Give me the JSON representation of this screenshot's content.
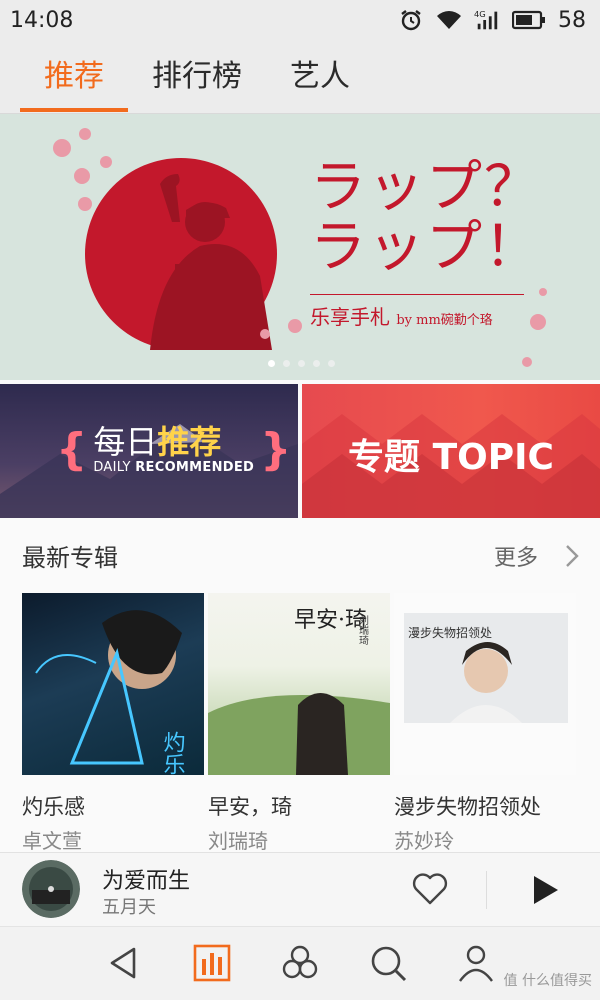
{
  "status": {
    "time": "14:08",
    "battery": "58",
    "network": "4G"
  },
  "tabs": [
    {
      "label": "推荐",
      "active": true
    },
    {
      "label": "排行榜",
      "active": false
    },
    {
      "label": "艺人",
      "active": false
    }
  ],
  "banner": {
    "title_line1": "ラップ？",
    "title_line2": "ラップ！",
    "subtitle": "乐享手札",
    "subtitle_by": "by mm碗勤个珞",
    "slide_count": 5,
    "active_slide": 1
  },
  "features": {
    "daily": {
      "cn_prefix": "每日",
      "cn_highlight": "推荐",
      "en_prefix": "DAILY",
      "en_highlight": "RECOMMENDED"
    },
    "topic": {
      "label": "专题 TOPIC"
    }
  },
  "latest": {
    "title": "最新专辑",
    "more": "更多",
    "albums": [
      {
        "title": "灼乐感",
        "artist": "卓文萱",
        "cover_text": "灼乐感"
      },
      {
        "title": "早安，琦",
        "artist": "刘瑞琦",
        "cover_text": "早安·琦",
        "cover_side": "刘瑞琦"
      },
      {
        "title": "漫步失物招领处",
        "artist": "苏妙玲",
        "cover_text": "漫步失物招领处"
      }
    ]
  },
  "player": {
    "title": "为爱而生",
    "artist": "五月天"
  },
  "watermark": "值 什么值得买",
  "colors": {
    "accent": "#f26b1d",
    "banner_red": "#c3182c",
    "banner_bg": "#d7e4dd"
  }
}
